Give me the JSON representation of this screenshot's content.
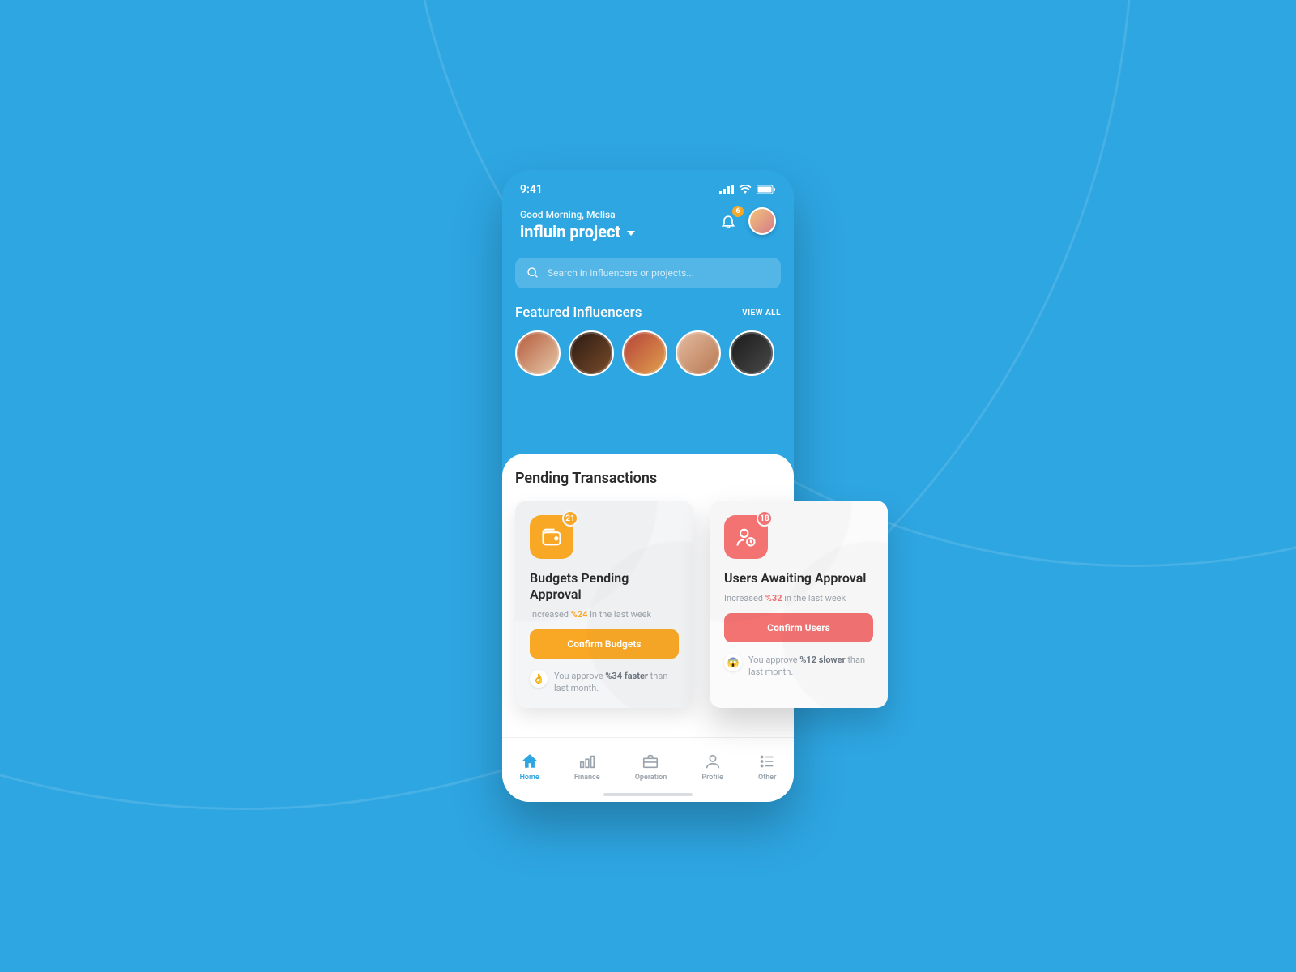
{
  "status": {
    "time": "9:41"
  },
  "header": {
    "greeting": "Good Morning, Melisa",
    "project": "influin project",
    "notification_count": "6"
  },
  "search": {
    "placeholder": "Search in influencers or projects..."
  },
  "featured": {
    "title": "Featured Influencers",
    "view_all": "VIEW ALL"
  },
  "sheet": {
    "title": "Pending Transactions"
  },
  "cards": {
    "budgets": {
      "badge": "21",
      "title": "Budgets Pending Approval",
      "sub_prefix": "Increased ",
      "sub_pct": "%24",
      "sub_suffix": " in the last week",
      "button": "Confirm Budgets",
      "note_emoji": "👌",
      "note_prefix": "You approve ",
      "note_pct": "%34 faster",
      "note_suffix": " than last month."
    },
    "users": {
      "badge": "18",
      "title": "Users Awaiting Approval",
      "sub_prefix": "Increased ",
      "sub_pct": "%32",
      "sub_suffix": " in the last week",
      "button": "Confirm Users",
      "note_emoji": "😱",
      "note_prefix": "You approve ",
      "note_pct": "%12 slower",
      "note_suffix": " than last month."
    }
  },
  "nav": {
    "home": "Home",
    "finance": "Finance",
    "operation": "Operation",
    "profile": "Profile",
    "other": "Other"
  }
}
